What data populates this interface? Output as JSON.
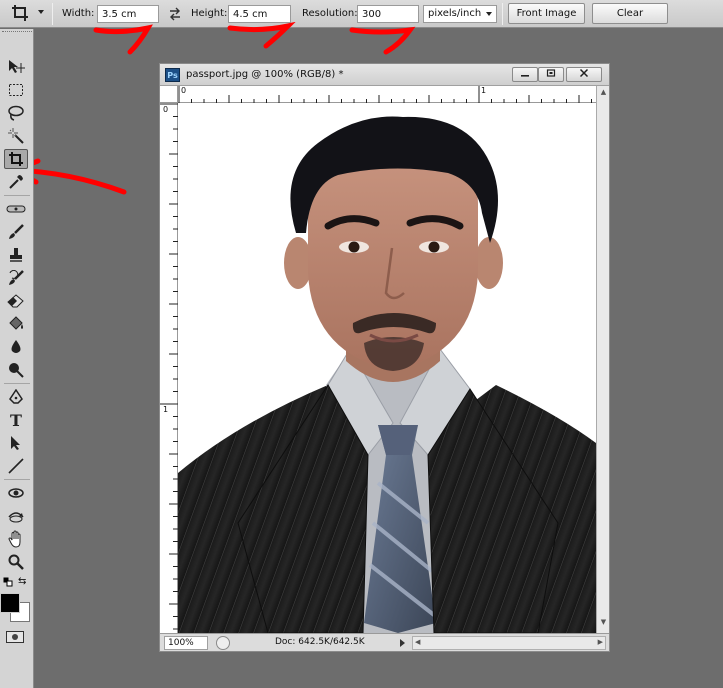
{
  "options_bar": {
    "width_label": "Width:",
    "width_value": "3.5 cm",
    "height_label": "Height:",
    "height_value": "4.5 cm",
    "resolution_label": "Resolution:",
    "resolution_value": "300",
    "resolution_unit": "pixels/inch",
    "front_image_label": "Front Image",
    "clear_label": "Clear"
  },
  "document": {
    "title": "passport.jpg @ 100% (RGB/8) *",
    "ps_badge": "Ps",
    "zoom": "100%",
    "doc_size": "Doc: 642.5K/642.5K",
    "ruler_top_labels": [
      "0",
      "1"
    ],
    "ruler_left_labels": [
      "0",
      "1"
    ]
  },
  "toolbar": {
    "tools": [
      "move-tool",
      "marquee-tool",
      "lasso-tool",
      "magic-wand-tool",
      "crop-tool",
      "eyedropper-tool",
      "healing-brush-tool",
      "brush-tool",
      "clone-stamp-tool",
      "history-brush-tool",
      "eraser-tool",
      "paint-bucket-tool",
      "blur-tool",
      "dodge-tool",
      "pen-tool",
      "type-tool",
      "path-selection-tool",
      "line-tool",
      "3d-rotate-tool",
      "3d-orbit-tool",
      "hand-tool",
      "zoom-tool"
    ],
    "active_tool": "crop-tool"
  },
  "colors": {
    "annotation_red": "#ff0000",
    "foreground": "#000000",
    "background": "#ffffff"
  }
}
